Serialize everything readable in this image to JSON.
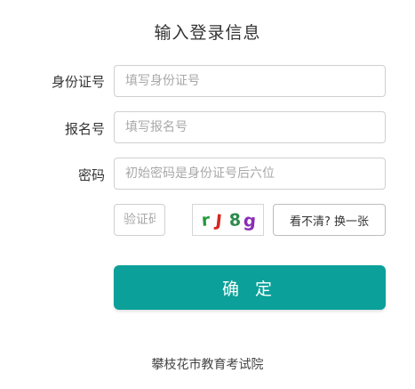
{
  "form": {
    "title": "输入登录信息",
    "id_card": {
      "label": "身份证号",
      "placeholder": "填写身份证号",
      "value": ""
    },
    "registration_no": {
      "label": "报名号",
      "placeholder": "填写报名号",
      "value": ""
    },
    "password": {
      "label": "密码",
      "placeholder": "初始密码是身份证号后六位",
      "value": ""
    },
    "captcha": {
      "placeholder": "验证码",
      "value": "",
      "image_chars": [
        {
          "char": "r",
          "color": "#1f9c3a"
        },
        {
          "char": "J",
          "color": "#d8261e"
        },
        {
          "char": "8",
          "color": "#2a8a4a"
        },
        {
          "char": "g",
          "color": "#8a2fb5"
        }
      ],
      "refresh_label": "看不清? 换一张"
    },
    "submit_label": "确 定"
  },
  "colors": {
    "accent": "#0ba099",
    "border": "#cfcfcf",
    "placeholder": "#a8a8a8"
  },
  "footer": {
    "text": "攀枝花市教育考试院"
  }
}
